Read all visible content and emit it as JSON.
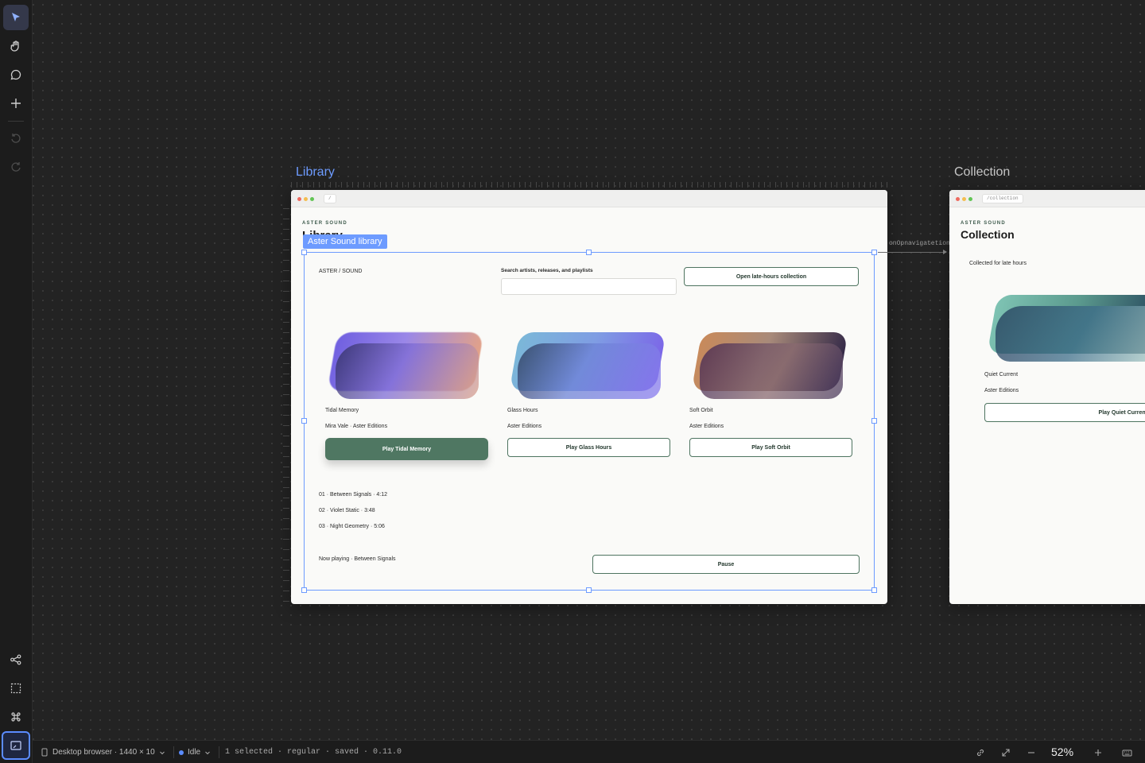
{
  "statusbar": {
    "device": "Desktop browser · 1440 × 10",
    "state": "Idle",
    "info": "1 selected · regular · saved · 0.11.0",
    "zoom": "52%"
  },
  "canvas": {
    "frames": [
      {
        "title": "Library",
        "url": "/"
      },
      {
        "title": "Collection",
        "url": "/collection"
      }
    ],
    "selection_label": "Aster Sound library",
    "connection_label": "onOpnavigatetion"
  },
  "library_page": {
    "brand_small": "ASTER SOUND",
    "heading": "Library",
    "brand": "ASTER / SOUND",
    "search_label": "Search artists, releases, and playlists",
    "search_placeholder": "",
    "open_collection_button": "Open late-hours collection",
    "albums": [
      {
        "title": "Tidal Memory",
        "artist": "Mira Vale · Aster Editions",
        "button": "Play Tidal Memory"
      },
      {
        "title": "Glass Hours",
        "artist": "Aster Editions",
        "button": "Play Glass Hours"
      },
      {
        "title": "Soft Orbit",
        "artist": "Aster Editions",
        "button": "Play Soft Orbit"
      }
    ],
    "tracks": [
      "01 · Between Signals · 4:12",
      "02 · Violet Static · 3:48",
      "03 · Night Geometry · 5:06"
    ],
    "now_playing": "Now playing · Between Signals",
    "pause_button": "Pause"
  },
  "collection_page": {
    "brand_small": "ASTER SOUND",
    "heading": "Collection",
    "subtitle": "Collected for late hours",
    "album_title": "Quiet Current",
    "album_artist": "Aster Editions",
    "button": "Play Quiet Current"
  },
  "colors": {
    "accent": "#6d9bff",
    "primary_button": "#4f7762",
    "canvas_bg": "#232323"
  }
}
